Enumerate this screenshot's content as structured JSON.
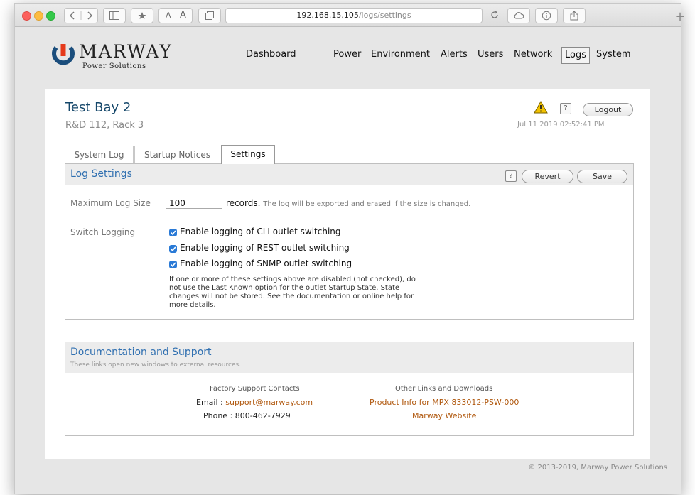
{
  "browser": {
    "url_host": "192.168.15.105",
    "url_path": "/logs/settings",
    "reader_text_small": "A",
    "reader_text_large": "A",
    "new_tab_symbol": "+"
  },
  "brand": {
    "name": "MARWAY",
    "subtitle": "Power Solutions"
  },
  "nav": {
    "items": [
      "Dashboard",
      "Power",
      "Environment",
      "Alerts",
      "Users",
      "Network",
      "Logs",
      "System"
    ],
    "active": "Logs"
  },
  "page": {
    "title": "Test Bay 2",
    "location": "R&D 112, Rack 3",
    "help_symbol": "?",
    "logout_label": "Logout",
    "timestamp": "Jul 11 2019 02:52:41 PM"
  },
  "tabs": [
    "System Log",
    "Startup Notices",
    "Settings"
  ],
  "log_settings": {
    "heading": "Log Settings",
    "help_symbol": "?",
    "revert_label": "Revert",
    "save_label": "Save",
    "max_size_label": "Maximum Log Size",
    "max_size_value": "100",
    "records_label": "records.",
    "records_note": "The log will be exported and erased if the size is changed.",
    "switch_label": "Switch Logging",
    "options": [
      {
        "label": "Enable logging of CLI outlet switching",
        "checked": true
      },
      {
        "label": "Enable logging of REST outlet switching",
        "checked": true
      },
      {
        "label": "Enable logging of SNMP outlet switching",
        "checked": true
      }
    ],
    "warning_lines": [
      "If one or more of these settings above are disabled (not checked), do",
      "not use the Last Known option for the outlet Startup State. State",
      "changes will not be stored. See the documentation or online help for",
      "more details."
    ]
  },
  "docs": {
    "heading": "Documentation and Support",
    "subheading": "These links open new windows to external resources.",
    "contacts_title": "Factory Support Contacts",
    "email_label": "Email : ",
    "email_value": "support@marway.com",
    "phone_label": "Phone : ",
    "phone_value": "800-462-7929",
    "links_title": "Other Links and Downloads",
    "product_link": "Product Info for MPX 833012-PSW-000",
    "website_link": "Marway Website"
  },
  "footer": "© 2013-2019, Marway Power Solutions",
  "colors": {
    "accent": "#2f6fb0",
    "title": "#15476a",
    "link": "#b0580e",
    "checkbox": "#2a7ad6",
    "warning": "#f2c200"
  }
}
